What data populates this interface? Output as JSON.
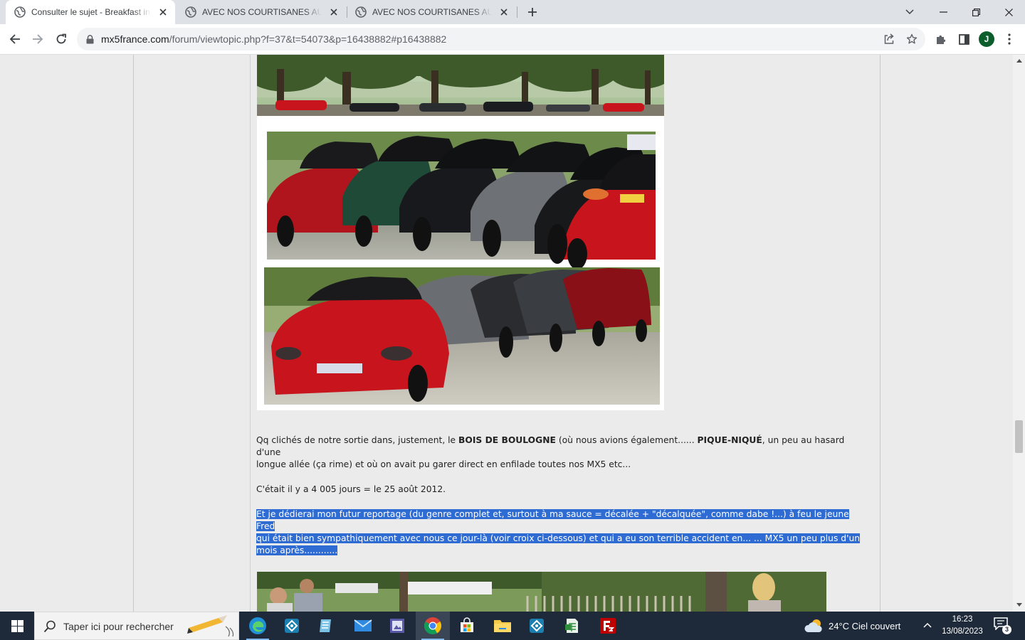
{
  "browser": {
    "tabs": [
      {
        "title": "Consulter le sujet - Breakfast in Paris",
        "active": true
      },
      {
        "title": "AVEC NOS COURTISANES AU BOIS",
        "active": false
      },
      {
        "title": "AVEC NOS COURTISANES AU BOIS",
        "active": false
      }
    ],
    "url_host": "mx5france.com",
    "url_path": "/forum/viewtopic.php?f=37&t=54073&p=16438882#p16438882",
    "profile_initial": "J"
  },
  "post": {
    "para1": {
      "t1": "Qq clichés de notre sortie dans, justement, le ",
      "b1": "BOIS DE BOULOGNE",
      "t2": " (où nous avions également...... ",
      "b2": "PIQUE-NIQUÉ",
      "t3": ", un peu au hasard d'une",
      "line2": "longue allée (ça rime) et où on avait pu garer direct en enfilade toutes nos MX5 etc..."
    },
    "para2": "C'était il y a 4 005 jours = le 25 août 2012.",
    "para3": {
      "line1": "Et je dédierai mon futur reportage (du genre complet et, surtout à ma sauce = décalée + \"décalquée\", comme dabe !...) à feu le jeune Fred",
      "line2": "qui était bien sympathiquement avec nous ce jour-là (voir croix ci-dessous) et qui a eu son terrible accident en... ... MX5 un peu plus d'un",
      "line3": "mois après............"
    }
  },
  "taskbar": {
    "search_placeholder": "Taper ici pour rechercher",
    "weather": "24°C  Ciel couvert",
    "time": "16:23",
    "date": "13/08/2023",
    "notification_count": "3"
  },
  "colors": {
    "selection": "#2e6bd2",
    "car_red": "#c8141c",
    "taskbar": "#1e2a3a"
  }
}
